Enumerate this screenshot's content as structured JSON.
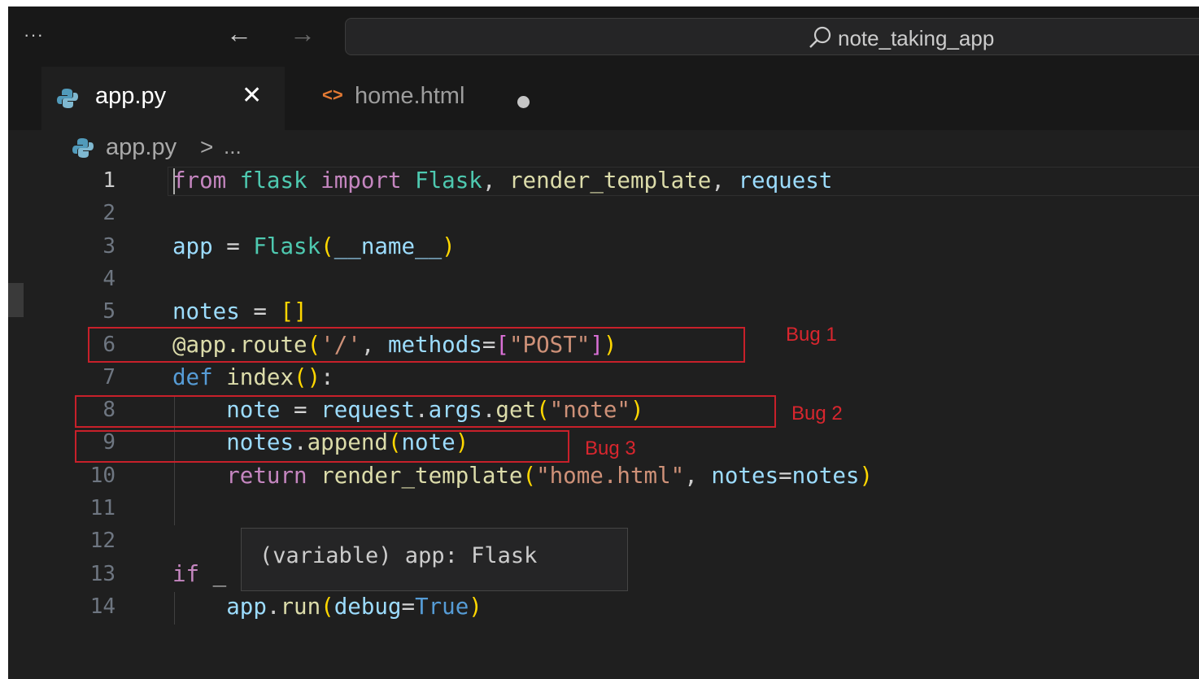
{
  "titlebar": {
    "more_label": "···",
    "back_arrow": "←",
    "forward_arrow": "→",
    "search_icon": "search-icon",
    "search_text": "note_taking_app"
  },
  "tabs": [
    {
      "label": "app.py",
      "icon": "python-file-icon",
      "close": "✕",
      "active": true
    },
    {
      "label": "home.html",
      "icon": "html-file-icon",
      "icon_glyph": "<>",
      "modified": true
    }
  ],
  "breadcrumb": {
    "file": "app.py",
    "separator": ">",
    "more": "..."
  },
  "editor": {
    "lines": [
      {
        "n": "1",
        "tokens": [
          [
            "kw",
            "from"
          ],
          [
            "pl",
            " "
          ],
          [
            "mod",
            "flask"
          ],
          [
            "pl",
            " "
          ],
          [
            "kw",
            "import"
          ],
          [
            "pl",
            " "
          ],
          [
            "cls",
            "Flask"
          ],
          [
            "pl",
            ", "
          ],
          [
            "fn",
            "render_template"
          ],
          [
            "pl",
            ", "
          ],
          [
            "var",
            "request"
          ]
        ]
      },
      {
        "n": "2",
        "tokens": []
      },
      {
        "n": "3",
        "tokens": [
          [
            "var",
            "app"
          ],
          [
            "op",
            " = "
          ],
          [
            "cls",
            "Flask"
          ],
          [
            "br1",
            "("
          ],
          [
            "var",
            "__name__"
          ],
          [
            "br1",
            ")"
          ]
        ]
      },
      {
        "n": "4",
        "tokens": []
      },
      {
        "n": "5",
        "tokens": [
          [
            "var",
            "notes"
          ],
          [
            "op",
            " = "
          ],
          [
            "br1",
            "[]"
          ]
        ]
      },
      {
        "n": "6",
        "tokens": [
          [
            "dec",
            "@app.route"
          ],
          [
            "br1",
            "("
          ],
          [
            "str",
            "'/'"
          ],
          [
            "pl",
            ", "
          ],
          [
            "var",
            "methods"
          ],
          [
            "op",
            "="
          ],
          [
            "br2",
            "["
          ],
          [
            "str",
            "\"POST\""
          ],
          [
            "br2",
            "]"
          ],
          [
            "br1",
            ")"
          ]
        ]
      },
      {
        "n": "7",
        "tokens": [
          [
            "kwb",
            "def"
          ],
          [
            "pl",
            " "
          ],
          [
            "fn",
            "index"
          ],
          [
            "br1",
            "()"
          ],
          [
            "pl",
            ":"
          ]
        ]
      },
      {
        "n": "8",
        "tokens": [
          [
            "pl",
            "    "
          ],
          [
            "var",
            "note"
          ],
          [
            "op",
            " = "
          ],
          [
            "var",
            "request"
          ],
          [
            "pl",
            "."
          ],
          [
            "var",
            "args"
          ],
          [
            "pl",
            "."
          ],
          [
            "fn",
            "get"
          ],
          [
            "br1",
            "("
          ],
          [
            "str",
            "\"note\""
          ],
          [
            "br1",
            ")"
          ]
        ]
      },
      {
        "n": "9",
        "tokens": [
          [
            "pl",
            "    "
          ],
          [
            "var",
            "notes"
          ],
          [
            "pl",
            "."
          ],
          [
            "fn",
            "append"
          ],
          [
            "br1",
            "("
          ],
          [
            "var",
            "note"
          ],
          [
            "br1",
            ")"
          ]
        ]
      },
      {
        "n": "10",
        "tokens": [
          [
            "pl",
            "    "
          ],
          [
            "kw",
            "return"
          ],
          [
            "pl",
            " "
          ],
          [
            "fn",
            "render_template"
          ],
          [
            "br1",
            "("
          ],
          [
            "str",
            "\"home.html\""
          ],
          [
            "pl",
            ", "
          ],
          [
            "var",
            "notes"
          ],
          [
            "op",
            "="
          ],
          [
            "var",
            "notes"
          ],
          [
            "br1",
            ")"
          ]
        ]
      },
      {
        "n": "11",
        "tokens": []
      },
      {
        "n": "12",
        "tokens": []
      },
      {
        "n": "13",
        "tokens": [
          [
            "kw",
            "if"
          ],
          [
            "pl",
            " _"
          ]
        ]
      },
      {
        "n": "14",
        "tokens": [
          [
            "pl",
            "    "
          ],
          [
            "var",
            "app"
          ],
          [
            "pl",
            "."
          ],
          [
            "fn",
            "run"
          ],
          [
            "br1",
            "("
          ],
          [
            "var",
            "debug"
          ],
          [
            "op",
            "="
          ],
          [
            "kwb",
            "True"
          ],
          [
            "br1",
            ")"
          ]
        ]
      }
    ]
  },
  "hover": {
    "text": "(variable) app: Flask"
  },
  "annotations": [
    {
      "label": "Bug 1",
      "line": "6"
    },
    {
      "label": "Bug 2",
      "line": "8"
    },
    {
      "label": "Bug 3",
      "line": "9"
    }
  ],
  "colors": {
    "annotation": "#c8202a",
    "editor_bg": "#1f1f1f",
    "keyword": "#c586c0",
    "string": "#ce9178"
  }
}
